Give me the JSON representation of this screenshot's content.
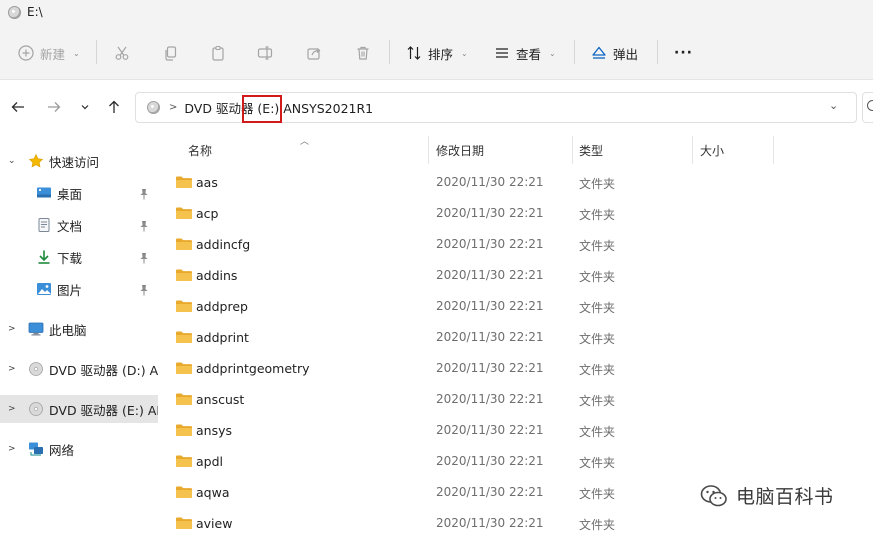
{
  "window": {
    "title": "E:\\"
  },
  "toolbar": {
    "new_label": "新建",
    "sort_label": "排序",
    "view_label": "查看",
    "eject_label": "弹出",
    "more_label": "···"
  },
  "address": {
    "segments": [
      "DVD 驱动器 (E:) ANSYS2021R1"
    ]
  },
  "sidebar": {
    "items": [
      {
        "label": "快速访问",
        "icon": "star-icon",
        "expand": "expanded"
      },
      {
        "label": "桌面",
        "icon": "desktop-icon",
        "pinned": true
      },
      {
        "label": "文档",
        "icon": "document-icon",
        "pinned": true
      },
      {
        "label": "下载",
        "icon": "download-icon",
        "pinned": true
      },
      {
        "label": "图片",
        "icon": "pictures-icon",
        "pinned": true
      },
      {
        "label": "此电脑",
        "icon": "computer-icon",
        "expand": "collapsed"
      },
      {
        "label": "DVD 驱动器 (D:) AN",
        "icon": "dvd-icon",
        "expand": "collapsed"
      },
      {
        "label": "DVD 驱动器 (E:) AN",
        "icon": "dvd-icon",
        "expand": "collapsed",
        "selected": true
      },
      {
        "label": "网络",
        "icon": "network-icon",
        "expand": "collapsed"
      }
    ]
  },
  "columns": {
    "name": "名称",
    "modified": "修改日期",
    "type": "类型",
    "size": "大小"
  },
  "files": [
    {
      "name": "aas",
      "modified": "2020/11/30 22:21",
      "type": "文件夹"
    },
    {
      "name": "acp",
      "modified": "2020/11/30 22:21",
      "type": "文件夹"
    },
    {
      "name": "addincfg",
      "modified": "2020/11/30 22:21",
      "type": "文件夹"
    },
    {
      "name": "addins",
      "modified": "2020/11/30 22:21",
      "type": "文件夹"
    },
    {
      "name": "addprep",
      "modified": "2020/11/30 22:21",
      "type": "文件夹"
    },
    {
      "name": "addprint",
      "modified": "2020/11/30 22:21",
      "type": "文件夹"
    },
    {
      "name": "addprintgeometry",
      "modified": "2020/11/30 22:21",
      "type": "文件夹"
    },
    {
      "name": "anscust",
      "modified": "2020/11/30 22:21",
      "type": "文件夹"
    },
    {
      "name": "ansys",
      "modified": "2020/11/30 22:21",
      "type": "文件夹"
    },
    {
      "name": "apdl",
      "modified": "2020/11/30 22:21",
      "type": "文件夹"
    },
    {
      "name": "aqwa",
      "modified": "2020/11/30 22:21",
      "type": "文件夹"
    },
    {
      "name": "aview",
      "modified": "2020/11/30 22:21",
      "type": "文件夹"
    }
  ],
  "watermark": {
    "text": "电脑百科书",
    "icon": "wechat-icon"
  },
  "colors": {
    "highlight": "#d11a1a",
    "folder": "#f4c24d",
    "selected": "#e5e5e5",
    "chrome": "#f3f3f3"
  }
}
